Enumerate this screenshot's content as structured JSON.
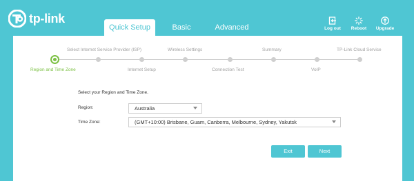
{
  "brand": {
    "name": "tp-link",
    "accent": "#4fc6d3",
    "active_step_color": "#7bc043"
  },
  "tabs": [
    {
      "label": "Quick Setup",
      "active": true
    },
    {
      "label": "Basic",
      "active": false
    },
    {
      "label": "Advanced",
      "active": false
    }
  ],
  "top_actions": [
    {
      "label": "Log out",
      "icon": "logout-icon"
    },
    {
      "label": "Reboot",
      "icon": "reboot-icon"
    },
    {
      "label": "Upgrade",
      "icon": "upgrade-icon"
    }
  ],
  "steps": {
    "current": 0,
    "items": [
      "Region and Time Zone",
      "Select Internet Service Provider (ISP)",
      "Internet Setup",
      "Wireless Settings",
      "Connection Test",
      "Summary",
      "VoIP",
      "TP-Link Cloud Service"
    ]
  },
  "form": {
    "prompt": "Select your Region and Time Zone.",
    "region_label": "Region:",
    "region_value": "Australia",
    "timezone_label": "Time Zone:",
    "timezone_value": "(GMT+10:00) Brisbane, Guam, Canberra, Melbourne, Sydney, Yakutsk"
  },
  "buttons": {
    "exit": "Exit",
    "next": "Next"
  }
}
